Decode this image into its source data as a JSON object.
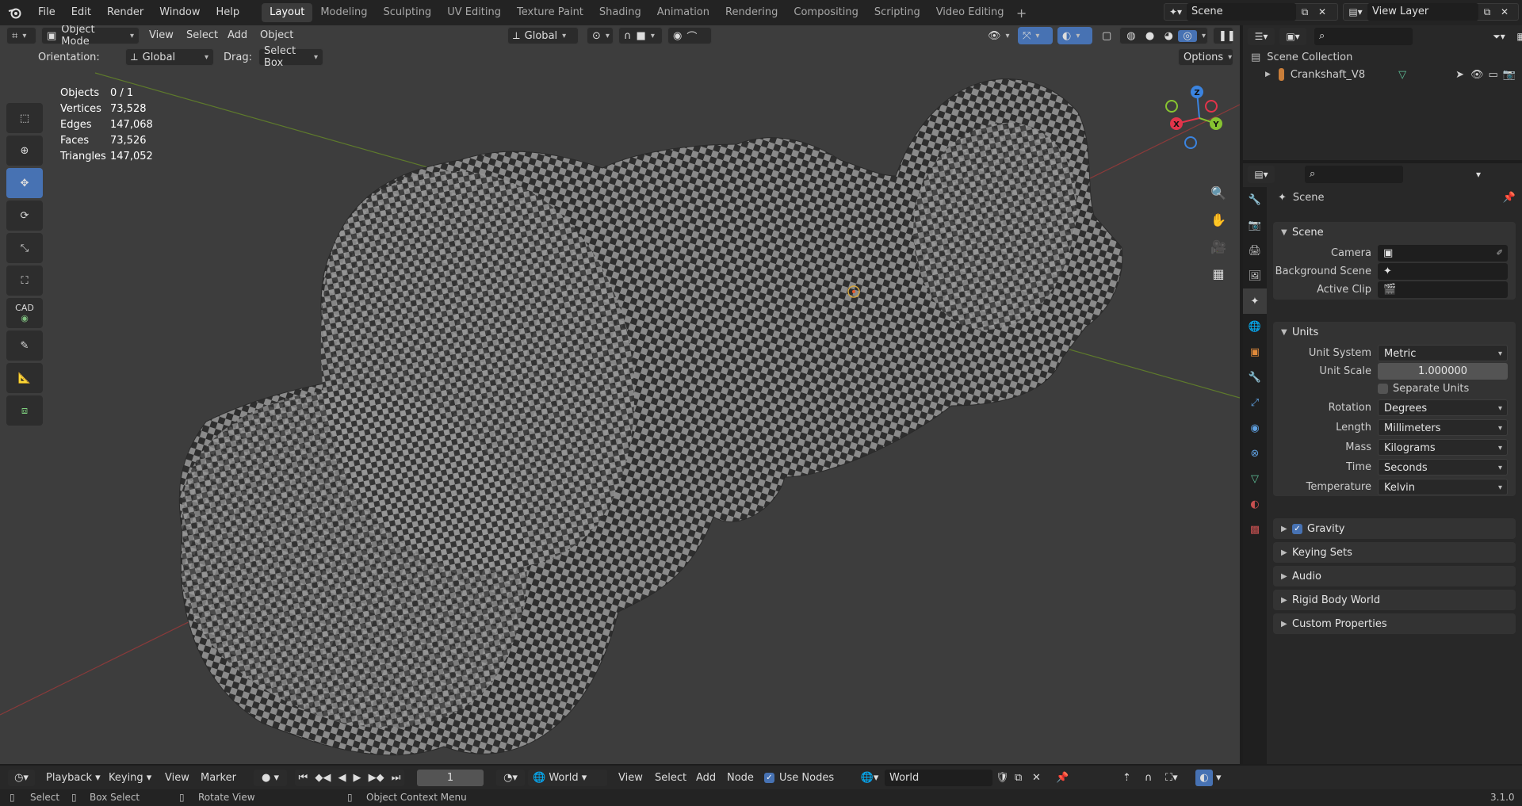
{
  "topbar": {
    "menus": [
      "File",
      "Edit",
      "Render",
      "Window",
      "Help"
    ],
    "workspaces": [
      "Layout",
      "Modeling",
      "Sculpting",
      "UV Editing",
      "Texture Paint",
      "Shading",
      "Animation",
      "Rendering",
      "Compositing",
      "Scripting",
      "Video Editing"
    ],
    "active_workspace": "Layout",
    "scene": "Scene",
    "view_layer": "View Layer"
  },
  "viewport": {
    "mode": "Object Mode",
    "menus": [
      "View",
      "Select",
      "Add",
      "Object"
    ],
    "transform_orientation": "Global",
    "orientation_label": "Orientation:",
    "orientation_value": "Global",
    "drag_label": "Drag:",
    "drag_value": "Select Box",
    "options_label": "Options",
    "stats": [
      {
        "k": "Objects",
        "v": "0 / 1"
      },
      {
        "k": "Vertices",
        "v": "73,528"
      },
      {
        "k": "Edges",
        "v": "147,068"
      },
      {
        "k": "Faces",
        "v": "73,526"
      },
      {
        "k": "Triangles",
        "v": "147,052"
      }
    ],
    "gizmo": {
      "x": "X",
      "y": "Y",
      "z": "Z"
    },
    "toolbar_cad_label": "CAD"
  },
  "outliner": {
    "root": "Scene Collection",
    "object": "Crankshaft_V8"
  },
  "properties": {
    "context": "Scene",
    "scene_panel": {
      "title": "Scene",
      "camera_label": "Camera",
      "background_label": "Background Scene",
      "clip_label": "Active Clip"
    },
    "units_panel": {
      "title": "Units",
      "unit_system_label": "Unit System",
      "unit_system": "Metric",
      "unit_scale_label": "Unit Scale",
      "unit_scale": "1.000000",
      "separate_units": "Separate Units",
      "rotation_label": "Rotation",
      "rotation": "Degrees",
      "length_label": "Length",
      "length": "Millimeters",
      "mass_label": "Mass",
      "mass": "Kilograms",
      "time_label": "Time",
      "time": "Seconds",
      "temperature_label": "Temperature",
      "temperature": "Kelvin"
    },
    "collapsed_panels": [
      "Gravity",
      "Keying Sets",
      "Audio",
      "Rigid Body World",
      "Custom Properties"
    ]
  },
  "timeline": {
    "playback": "Playback",
    "keying": "Keying",
    "view": "View",
    "marker": "Marker",
    "frame": "1",
    "world_selector": "World",
    "menus": [
      "View",
      "Select",
      "Add",
      "Node"
    ],
    "use_nodes": "Use Nodes",
    "world_name": "World"
  },
  "statusbar": {
    "select": "Select",
    "box_select": "Box Select",
    "rotate_view": "Rotate View",
    "context_menu": "Object Context Menu",
    "version": "3.1.0"
  },
  "colors": {
    "accent": "#4772b3",
    "x_axis": "#e2344a",
    "y_axis": "#87c431",
    "z_axis": "#3b84e0"
  }
}
